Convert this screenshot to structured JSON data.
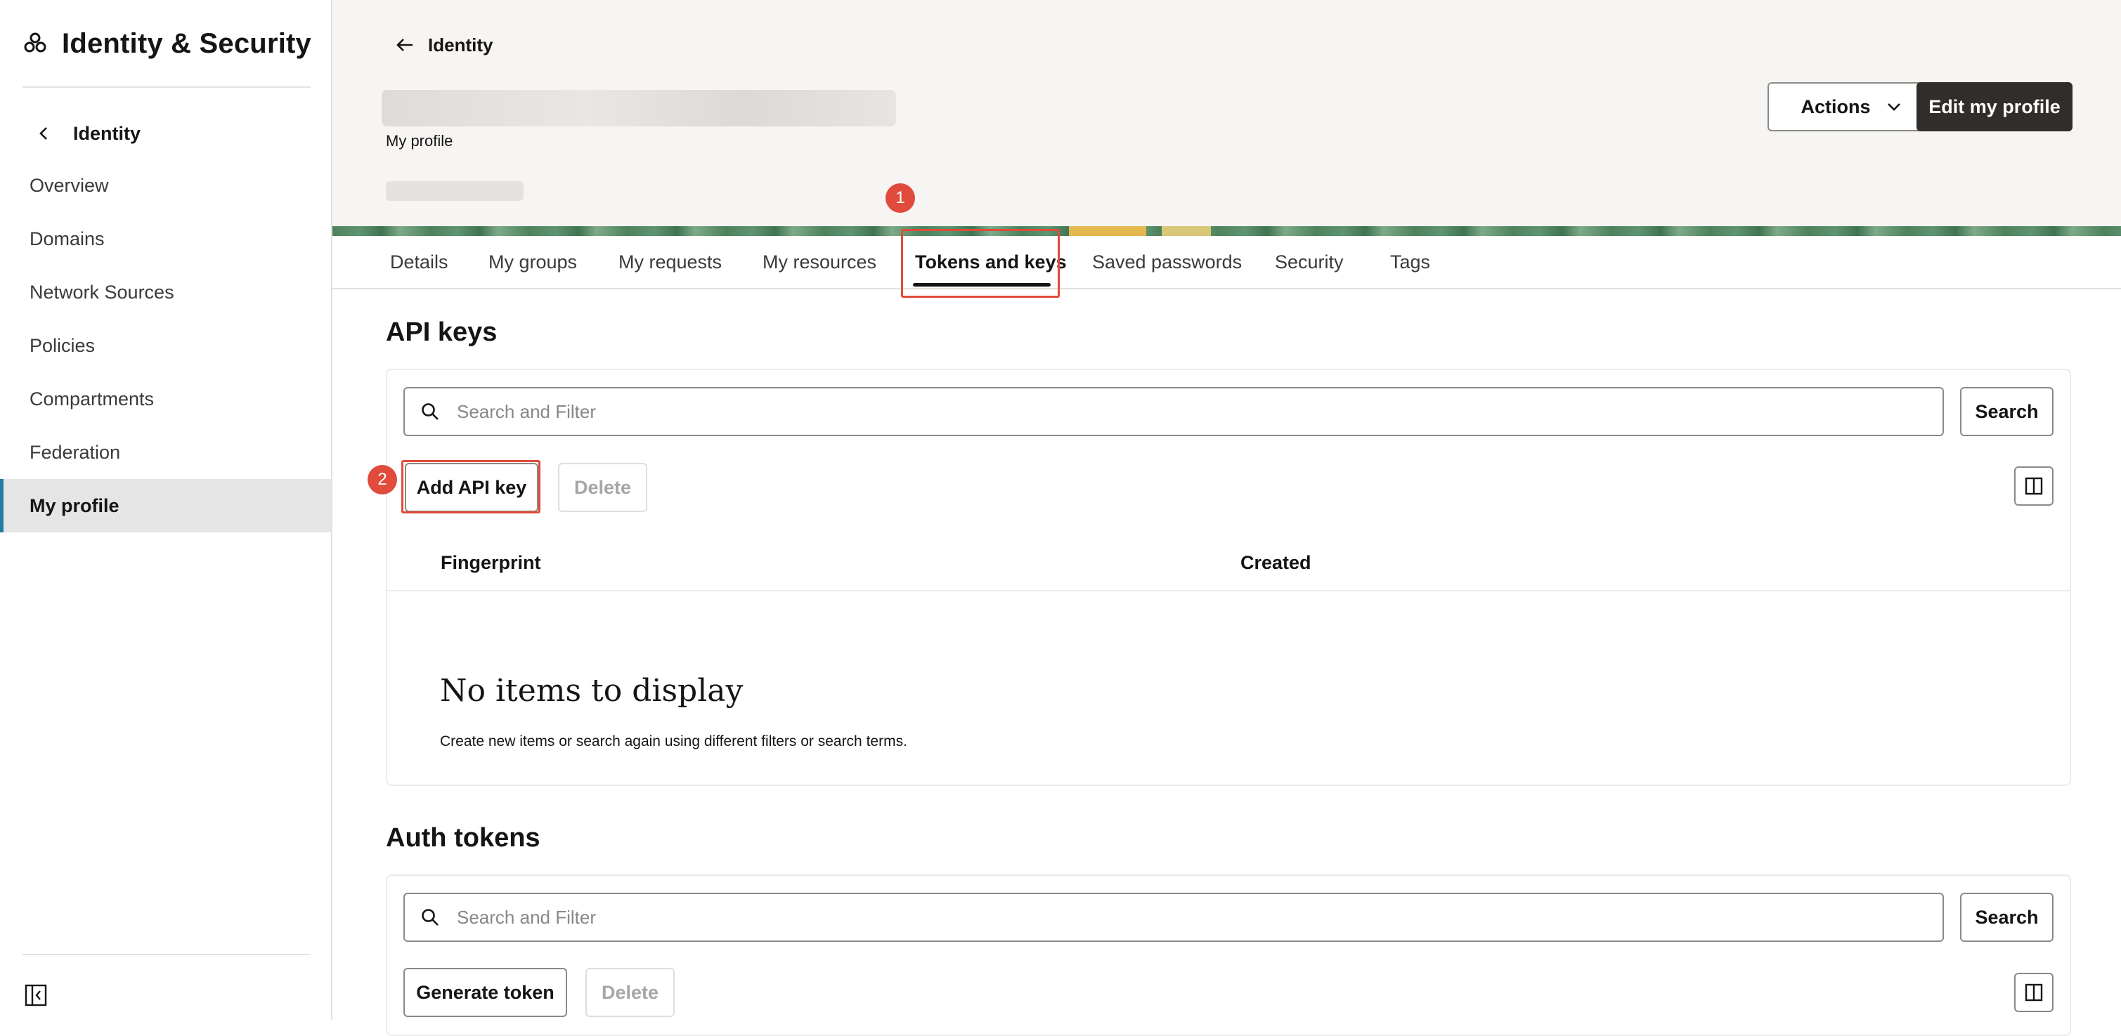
{
  "sidebar": {
    "title": "Identity & Security",
    "back_label": "Identity",
    "items": [
      {
        "label": "Overview"
      },
      {
        "label": "Domains"
      },
      {
        "label": "Network Sources"
      },
      {
        "label": "Policies"
      },
      {
        "label": "Compartments"
      },
      {
        "label": "Federation"
      },
      {
        "label": "My profile",
        "active": true
      }
    ]
  },
  "header": {
    "back_label": "Identity",
    "subtitle": "My profile",
    "actions_label": "Actions",
    "edit_label": "Edit my profile"
  },
  "tabs": [
    {
      "label": "Details"
    },
    {
      "label": "My groups"
    },
    {
      "label": "My requests"
    },
    {
      "label": "My resources"
    },
    {
      "label": "Tokens and keys",
      "active": true
    },
    {
      "label": "Saved passwords"
    },
    {
      "label": "Security"
    },
    {
      "label": "Tags"
    }
  ],
  "annotations": {
    "tab_step": "1",
    "add_key_step": "2",
    "color": "#e04b3c"
  },
  "api_keys": {
    "title": "API keys",
    "search_placeholder": "Search and Filter",
    "search_button": "Search",
    "add_button": "Add API key",
    "delete_button": "Delete",
    "columns": [
      "Fingerprint",
      "Created"
    ],
    "empty_title": "No items to display",
    "empty_desc": "Create new items or search again using different filters or search terms."
  },
  "auth_tokens": {
    "title": "Auth tokens",
    "search_placeholder": "Search and Filter",
    "search_button": "Search",
    "generate_button": "Generate token",
    "delete_button": "Delete"
  },
  "colors": {
    "accent": "#227e9e",
    "primary_button": "#312d2a",
    "header_bg": "#f7f5f3"
  }
}
